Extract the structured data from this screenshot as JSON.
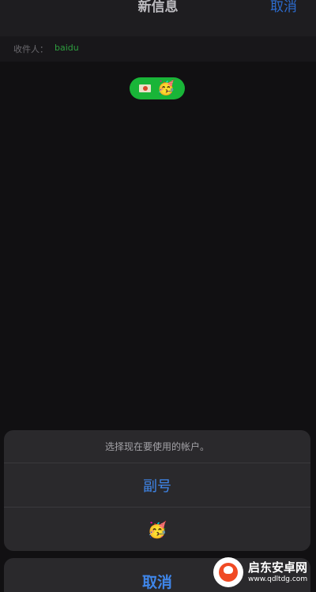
{
  "nav": {
    "title": "新信息",
    "cancel_label": "取消"
  },
  "recipient": {
    "label": "收件人：",
    "value": "baidu"
  },
  "message_bubble": {
    "emoji": "🥳",
    "flag_icon": "flag-icon"
  },
  "action_sheet": {
    "message": "选择现在要使用的帐户。",
    "options": [
      {
        "label": "副号"
      },
      {
        "label": "🥳"
      }
    ],
    "cancel_label": "取消"
  },
  "watermark": {
    "name": "启东安卓网",
    "url": "www.qdltdg.com"
  },
  "colors": {
    "accent": "#3f86ea",
    "bubble": "#19b538",
    "recipient": "#2e9e3f",
    "background": "#111012"
  }
}
